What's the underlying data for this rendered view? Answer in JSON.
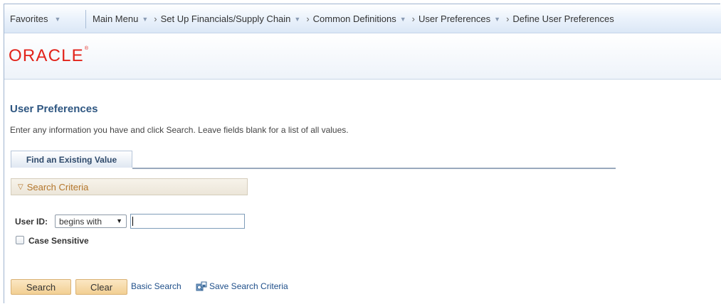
{
  "nav": {
    "favorites": "Favorites",
    "main_menu": "Main Menu",
    "path": [
      {
        "label": "Set Up Financials/Supply Chain",
        "has_caret": true
      },
      {
        "label": "Common Definitions",
        "has_caret": true
      },
      {
        "label": "User Preferences",
        "has_caret": true
      },
      {
        "label": "Define User Preferences",
        "has_caret": false
      }
    ]
  },
  "brand": {
    "logo_text": "ORACLE",
    "logo_color": "#e2231a"
  },
  "page": {
    "title": "User Preferences",
    "instructions": "Enter any information you have and click Search. Leave fields blank for a list of all values."
  },
  "tabs": [
    {
      "label": "Find an Existing Value",
      "active": true
    }
  ],
  "search_criteria": {
    "header": "Search Criteria",
    "user_id_label": "User ID:",
    "operator_selected": "begins with",
    "user_id_value": "",
    "case_sensitive_label": "Case Sensitive",
    "case_sensitive_checked": false
  },
  "actions": {
    "search_label": "Search",
    "clear_label": "Clear",
    "basic_search_label": "Basic Search",
    "save_criteria_label": "Save Search Criteria"
  },
  "colors": {
    "title_blue": "#2e5681",
    "button_bg": "#f2cf93",
    "link_blue": "#1f4f8a",
    "criteria_text": "#b4762c"
  },
  "icons": {
    "dropdown": "chevron-down-icon",
    "breadcrumb_separator": "chevron-right-icon",
    "criteria_toggle": "triangle-down-icon",
    "save_search": "save-search-icon"
  }
}
